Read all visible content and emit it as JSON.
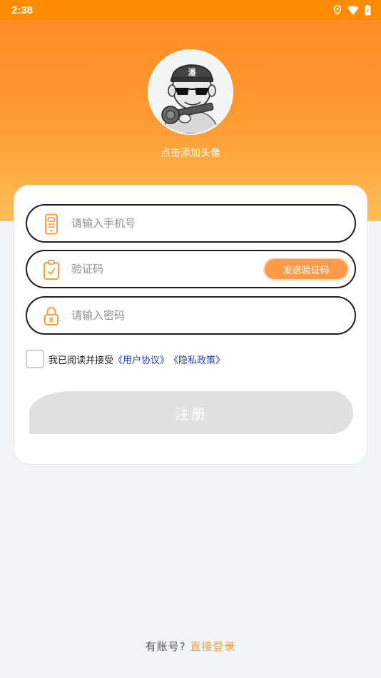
{
  "status_bar": {
    "time": "2:38",
    "icons": [
      "location-icon",
      "wifi-icon",
      "battery-icon"
    ]
  },
  "avatar": {
    "caption": "点击添加头像"
  },
  "form": {
    "phone_placeholder": "请输入手机号",
    "code_placeholder": "验证码",
    "send_code_label": "发送验证码",
    "password_placeholder": "请输入密码",
    "agree_text": "我已阅读并接受",
    "user_agreement": "《用户协议》",
    "privacy_policy": "《隐私政策》",
    "register_label": "注册"
  },
  "footer": {
    "question": "有账号?",
    "login_link": "直接登录"
  },
  "colors": {
    "accent": "#ff9a3d",
    "status_bar": "#ff8c00",
    "link": "#1f3fbf",
    "button_disabled": "#e0e0e0"
  }
}
